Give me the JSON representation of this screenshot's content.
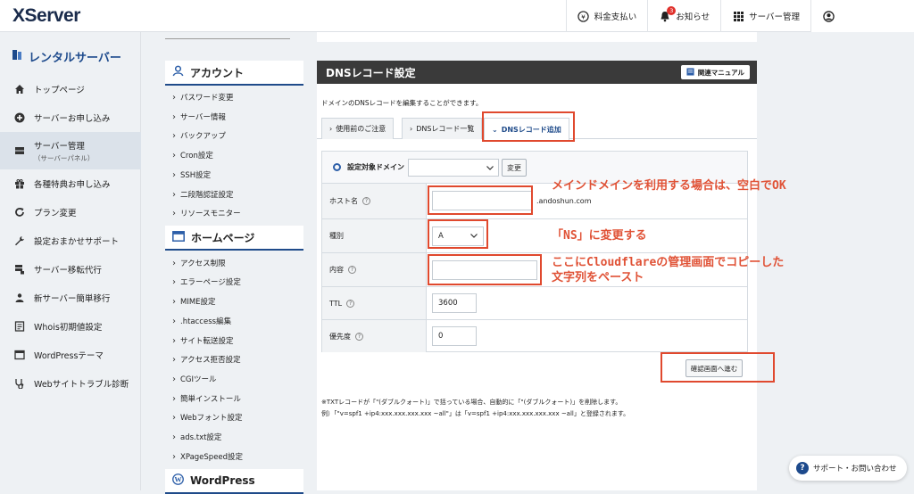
{
  "app": {
    "logo": "XServer"
  },
  "topnav": {
    "payment": "料金支払い",
    "notices": "お知らせ",
    "notices_badge": "3",
    "server_manage": "サーバー管理"
  },
  "sidebar": {
    "title": "レンタルサーバー",
    "items": [
      {
        "label": "トップページ",
        "icon": "home-icon"
      },
      {
        "label": "サーバーお申し込み",
        "icon": "plus-circle-icon"
      },
      {
        "label": "サーバー管理",
        "sub": "（サーバーパネル）",
        "icon": "server-icon"
      },
      {
        "label": "各種特典お申し込み",
        "icon": "gift-icon"
      },
      {
        "label": "プラン変更",
        "icon": "refresh-icon"
      },
      {
        "label": "設定おまかせサポート",
        "icon": "wrench-icon"
      },
      {
        "label": "サーバー移転代行",
        "icon": "server-move-icon"
      },
      {
        "label": "新サーバー簡単移行",
        "icon": "user-move-icon"
      },
      {
        "label": "Whois初期値設定",
        "icon": "document-icon"
      },
      {
        "label": "WordPressテーマ",
        "icon": "window-icon"
      },
      {
        "label": "Webサイトトラブル診断",
        "icon": "stethoscope-icon"
      }
    ]
  },
  "account_panel": {
    "title": "アカウント",
    "links": [
      "パスワード変更",
      "サーバー情報",
      "バックアップ",
      "Cron設定",
      "SSH設定",
      "二段階認証設定",
      "リソースモニター"
    ]
  },
  "homepage_panel": {
    "title": "ホームページ",
    "links": [
      "アクセス制限",
      "エラーページ設定",
      "MIME設定",
      ".htaccess編集",
      "サイト転送設定",
      "アクセス拒否設定",
      "CGIツール",
      "簡単インストール",
      "Webフォント設定",
      "ads.txt設定",
      "XPageSpeed設定"
    ]
  },
  "wordpress_panel": {
    "title": "WordPress"
  },
  "main": {
    "title": "DNSレコード設定",
    "manual_button": "関連マニュアル",
    "description": "ドメインのDNSレコードを編集することができます。",
    "tabs": [
      "使用前のご注意",
      "DNSレコード一覧",
      "DNSレコード追加"
    ],
    "domain_label": "設定対象ドメイン",
    "change_button": "変更",
    "form": {
      "host_label": "ホスト名",
      "host_value": "",
      "host_suffix": ".andoshun.com",
      "type_label": "種別",
      "type_value": "A",
      "content_label": "内容",
      "content_value": "",
      "ttl_label": "TTL",
      "ttl_value": "3600",
      "priority_label": "優先度",
      "priority_value": "0"
    },
    "confirm_button": "確認画面へ進む",
    "note1": "※TXTレコードが「\"(ダブルクォート)」で括っている場合、自動的に「\"(ダブルクォート)」を削除します。",
    "note2": "例）「\"v=spf1 +ip4:xxx.xxx.xxx.xxx ~all\"」は「v=spf1 +ip4:xxx.xxx.xxx.xxx ~all」と登録されます。"
  },
  "annotations": {
    "host": "メインドメインを利用する場合は、空白でOK",
    "type": "「NS」に変更する",
    "content_line1": "ここにCloudflareの管理画面でコピーした",
    "content_line2": "文字列をペースト"
  },
  "support": {
    "label": "サポート・お問い合わせ"
  },
  "colors": {
    "annotation": "#e05236",
    "brand": "#1d4a8c",
    "header_dark": "#3a3a3a"
  }
}
